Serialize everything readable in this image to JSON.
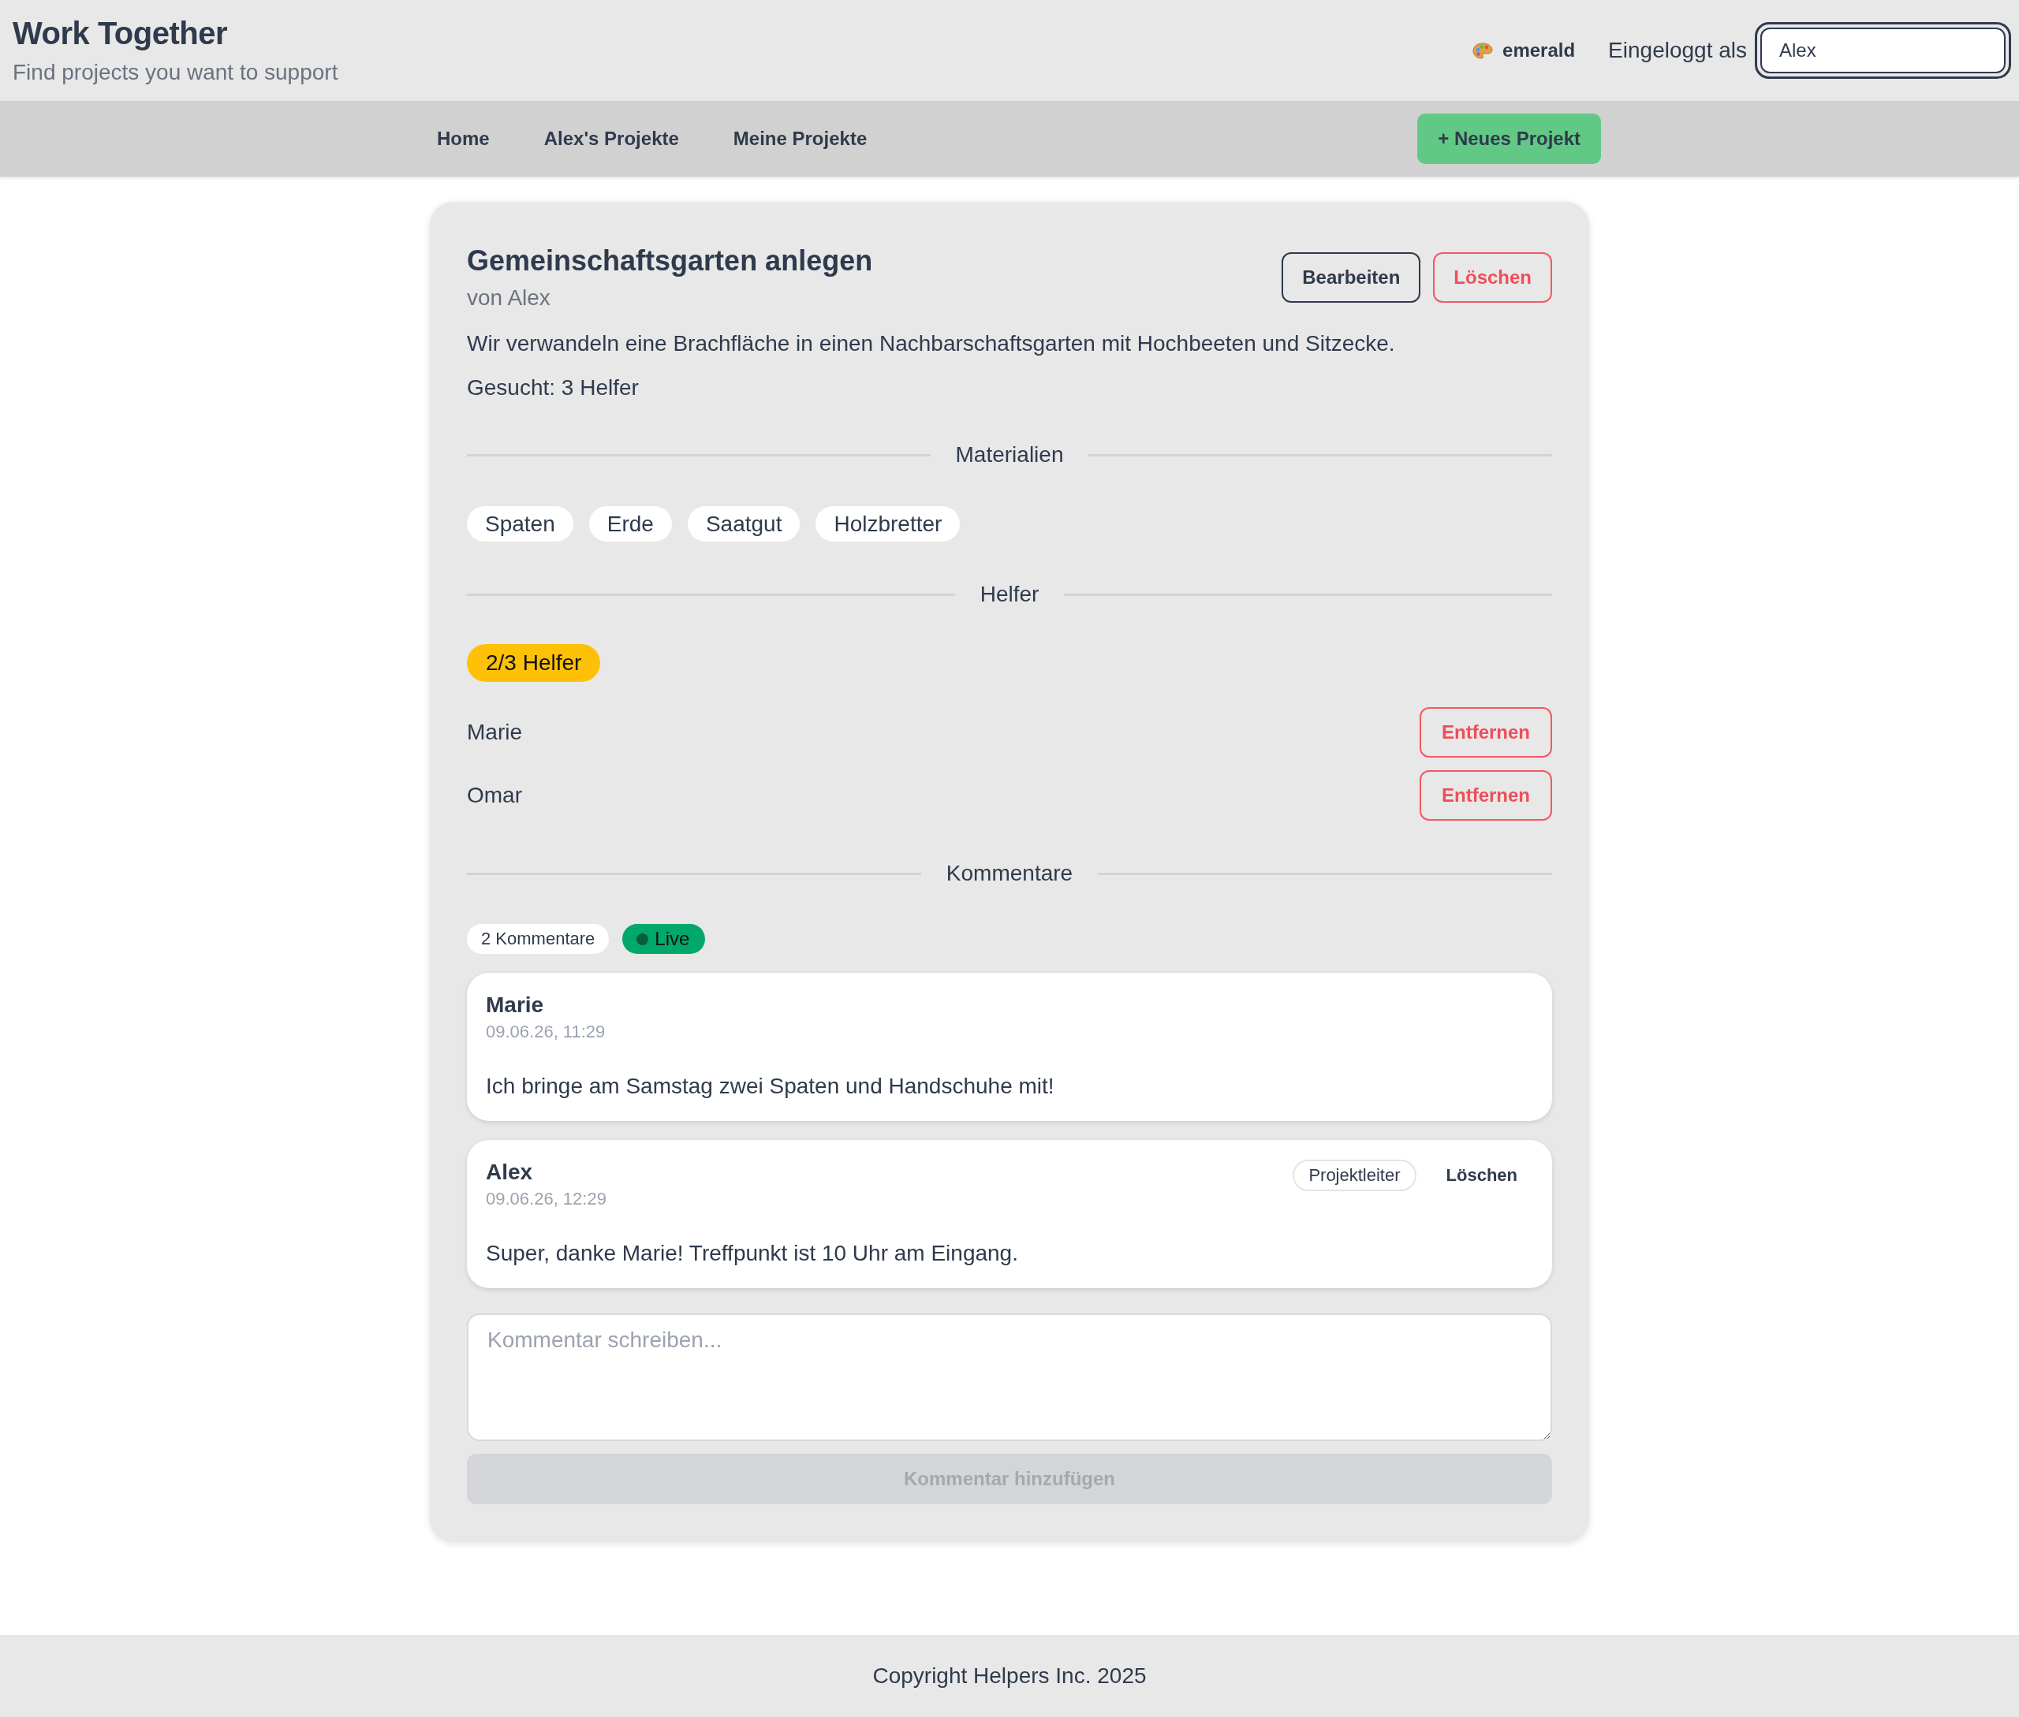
{
  "header": {
    "title": "Work Together",
    "subtitle": "Find projects you want to support",
    "theme_picker": {
      "label": "emerald"
    },
    "login": {
      "label": "Eingeloggt als",
      "value": "Alex",
      "focused": true
    }
  },
  "nav": {
    "links": [
      {
        "label": "Home"
      },
      {
        "label": "Alex's Projekte"
      },
      {
        "label": "Meine Projekte"
      }
    ],
    "new_project_button": "+ Neues Projekt"
  },
  "project": {
    "title": "Gemeinschaftsgarten anlegen",
    "author": "von Alex",
    "actions": [
      {
        "label": "Bearbeiten",
        "kind": "edit"
      },
      {
        "label": "Löschen",
        "kind": "delete"
      }
    ],
    "description": "Wir verwandeln eine Brachfläche in einen Nachbarschaftsgarten mit Hochbeeten und Sitzecke.",
    "wanted": "Gesucht: 3 Helfer",
    "materials": {
      "heading": "Materialien",
      "items": [
        "Spaten",
        "Erde",
        "Saatgut",
        "Holzbretter"
      ]
    },
    "helpers": {
      "heading": "Helfer",
      "badge": "2/3 Helfer",
      "list": [
        {
          "name": "Marie",
          "action": "Entfernen"
        },
        {
          "name": "Omar",
          "action": "Entfernen"
        }
      ]
    },
    "comments": {
      "heading": "Kommentare",
      "count": "2 Kommentare",
      "live": "Live",
      "items": [
        {
          "author": "Marie",
          "time": "09.06.26, 11:29",
          "text": "Ich bringe am Samstag zwei Spaten und Handschuhe mit!"
        },
        {
          "author": "Alex",
          "time": "09.06.26, 12:29",
          "text": "Super, danke Marie! Treffpunkt ist 10 Uhr am Eingang.",
          "role": "Projektleiter",
          "delete": "Löschen"
        }
      ],
      "input": {
        "placeholder": "Kommentar schreiben..."
      },
      "submit": {
        "label": "Kommentar hinzufügen",
        "disabled": true
      }
    }
  },
  "footer": {
    "text": "Copyright Helpers Inc. 2025"
  }
}
